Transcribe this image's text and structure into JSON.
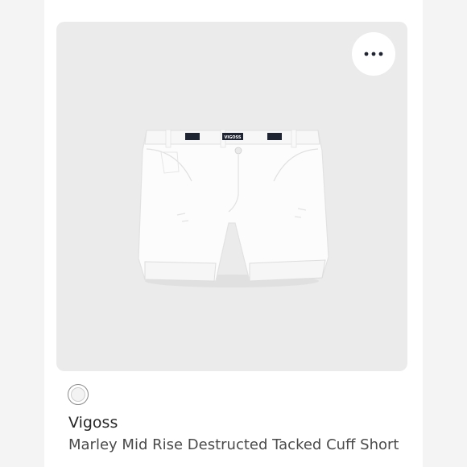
{
  "card": {
    "more_icon": "more-horizontal-icon",
    "image_alt": "white denim cuffed shorts",
    "swatch_color": "#f3f3f3",
    "brand": "Vigoss",
    "product_name": "Marley Mid Rise Destructed Tacked Cuff Short",
    "waistband_tags": [
      "VIGOSS"
    ]
  },
  "colors": {
    "page_bg": "#f4f4f4",
    "card_bg": "#ffffff",
    "image_bg": "#ebebeb",
    "text_primary": "#262626",
    "text_secondary": "#4a4a4a"
  }
}
